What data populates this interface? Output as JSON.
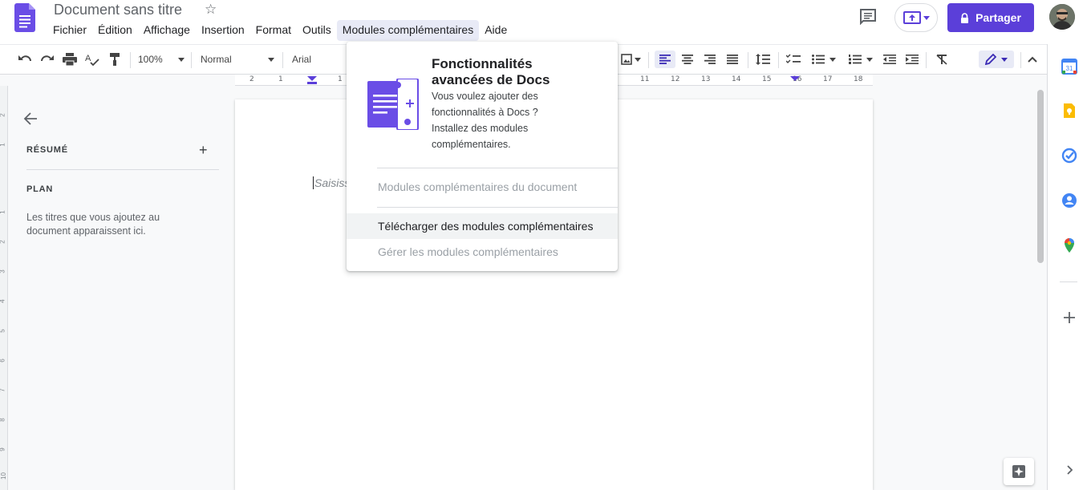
{
  "header": {
    "doc_title": "Document sans titre",
    "menu": [
      "Fichier",
      "Édition",
      "Affichage",
      "Insertion",
      "Format",
      "Outils",
      "Modules complémentaires",
      "Aide"
    ],
    "share_label": "Partager",
    "icons": [
      "docs-logo-icon",
      "star-icon",
      "comment-icon",
      "present-icon",
      "lock-icon",
      "avatar"
    ]
  },
  "toolbar": {
    "zoom": "100%",
    "style": "Normal",
    "font": "Arial"
  },
  "ruler": {
    "numbers": [
      "2",
      "1",
      "1",
      "11",
      "12",
      "13",
      "14",
      "15",
      "16",
      "17",
      "18"
    ],
    "vertical_numbers": [
      "2",
      "1",
      "1",
      "2",
      "3",
      "4",
      "5",
      "6",
      "7",
      "8",
      "9",
      "10"
    ]
  },
  "outline_panel": {
    "summary_label": "RÉSUMÉ",
    "plan_label": "PLAN",
    "hint": "Les titres que vous ajoutez au document apparaissent ici."
  },
  "page": {
    "placeholder": "Saisiss"
  },
  "addons_menu": {
    "heading": "Fonctionnalités avancées de Docs",
    "description": "Vous voulez ajouter des fonctionnalités à Docs ? Installez des modules complémentaires.",
    "items": [
      {
        "label": "Modules complémentaires du document",
        "enabled": false
      },
      {
        "label": "Télécharger des modules complémentaires",
        "enabled": true,
        "highlighted": true
      },
      {
        "label": "Gérer les modules complémentaires",
        "enabled": false
      }
    ]
  },
  "side_panel": {
    "apps": [
      "calendar-icon",
      "keep-icon",
      "tasks-icon",
      "contacts-icon",
      "maps-icon",
      "add-icon",
      "expand-icon"
    ]
  },
  "colors": {
    "brand": "#5b3fd9",
    "menu_active_bg": "#e8eaf6"
  }
}
